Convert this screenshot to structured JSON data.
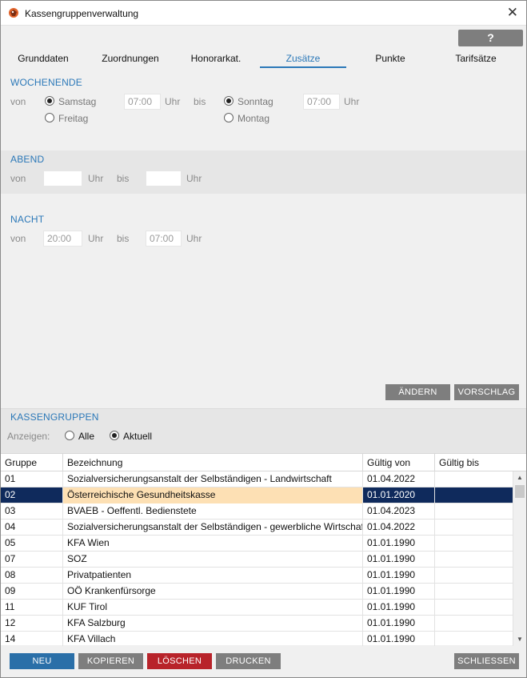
{
  "window": {
    "title": "Kassengruppenverwaltung",
    "close_glyph": "✕",
    "help_label": "?"
  },
  "tabs": [
    {
      "label": "Grunddaten"
    },
    {
      "label": "Zuordnungen"
    },
    {
      "label": "Honorarkat."
    },
    {
      "label": "Zusätze"
    },
    {
      "label": "Punkte"
    },
    {
      "label": "Tarifsätze"
    }
  ],
  "active_tab": "Zusätze",
  "wochenende": {
    "title": "WOCHENENDE",
    "von": "von",
    "bis": "bis",
    "uhr": "Uhr",
    "start_options": [
      {
        "label": "Samstag",
        "checked": true
      },
      {
        "label": "Freitag",
        "checked": false
      }
    ],
    "start_time": "07:00",
    "end_options": [
      {
        "label": "Sonntag",
        "checked": true
      },
      {
        "label": "Montag",
        "checked": false
      }
    ],
    "end_time": "07:00"
  },
  "abend": {
    "title": "ABEND",
    "von": "von",
    "bis": "bis",
    "uhr": "Uhr",
    "from": "",
    "to": ""
  },
  "nacht": {
    "title": "NACHT",
    "von": "von",
    "bis": "bis",
    "uhr": "Uhr",
    "from": "20:00",
    "to": "07:00"
  },
  "actions": {
    "aendern": "ÄNDERN",
    "vorschlag": "VORSCHLAG"
  },
  "kassengruppen": {
    "title": "KASSENGRUPPEN",
    "anzeigen_label": "Anzeigen:",
    "filter_options": [
      {
        "label": "Alle",
        "checked": false
      },
      {
        "label": "Aktuell",
        "checked": true
      }
    ],
    "columns": [
      "Gruppe",
      "Bezeichnung",
      "Gültig von",
      "Gültig bis"
    ],
    "rows": [
      {
        "gruppe": "01",
        "bezeichnung": "Sozialversicherungsanstalt der Selbständigen - Landwirtschaft",
        "von": "01.04.2022",
        "bis": ""
      },
      {
        "gruppe": "02",
        "bezeichnung": "Österreichische Gesundheitskasse",
        "von": "01.01.2020",
        "bis": "",
        "selected": true
      },
      {
        "gruppe": "03",
        "bezeichnung": "BVAEB - Oeffentl. Bedienstete",
        "von": "01.04.2023",
        "bis": ""
      },
      {
        "gruppe": "04",
        "bezeichnung": "Sozialversicherungsanstalt der Selbständigen - gewerbliche Wirtschaft",
        "von": "01.04.2022",
        "bis": ""
      },
      {
        "gruppe": "05",
        "bezeichnung": "KFA Wien",
        "von": "01.01.1990",
        "bis": ""
      },
      {
        "gruppe": "07",
        "bezeichnung": "SOZ",
        "von": "01.01.1990",
        "bis": ""
      },
      {
        "gruppe": "08",
        "bezeichnung": "Privatpatienten",
        "von": "01.01.1990",
        "bis": ""
      },
      {
        "gruppe": "09",
        "bezeichnung": "OÖ Krankenfürsorge",
        "von": "01.01.1990",
        "bis": ""
      },
      {
        "gruppe": "11",
        "bezeichnung": "KUF Tirol",
        "von": "01.01.1990",
        "bis": ""
      },
      {
        "gruppe": "12",
        "bezeichnung": "KFA Salzburg",
        "von": "01.01.1990",
        "bis": ""
      },
      {
        "gruppe": "14",
        "bezeichnung": "KFA Villach",
        "von": "01.01.1990",
        "bis": ""
      }
    ]
  },
  "footer": {
    "neu": "NEU",
    "kopieren": "KOPIEREN",
    "loeschen": "LÖSCHEN",
    "drucken": "DRUCKEN",
    "schliessen": "SCHLIESSEN"
  },
  "colors": {
    "accent": "#2b78b8",
    "selected_row": "#0f2a5c",
    "selected_cell": "#fde0b4",
    "delete": "#b8232a",
    "primary": "#2a6fa8",
    "neutral_button": "#7e7e7e"
  }
}
